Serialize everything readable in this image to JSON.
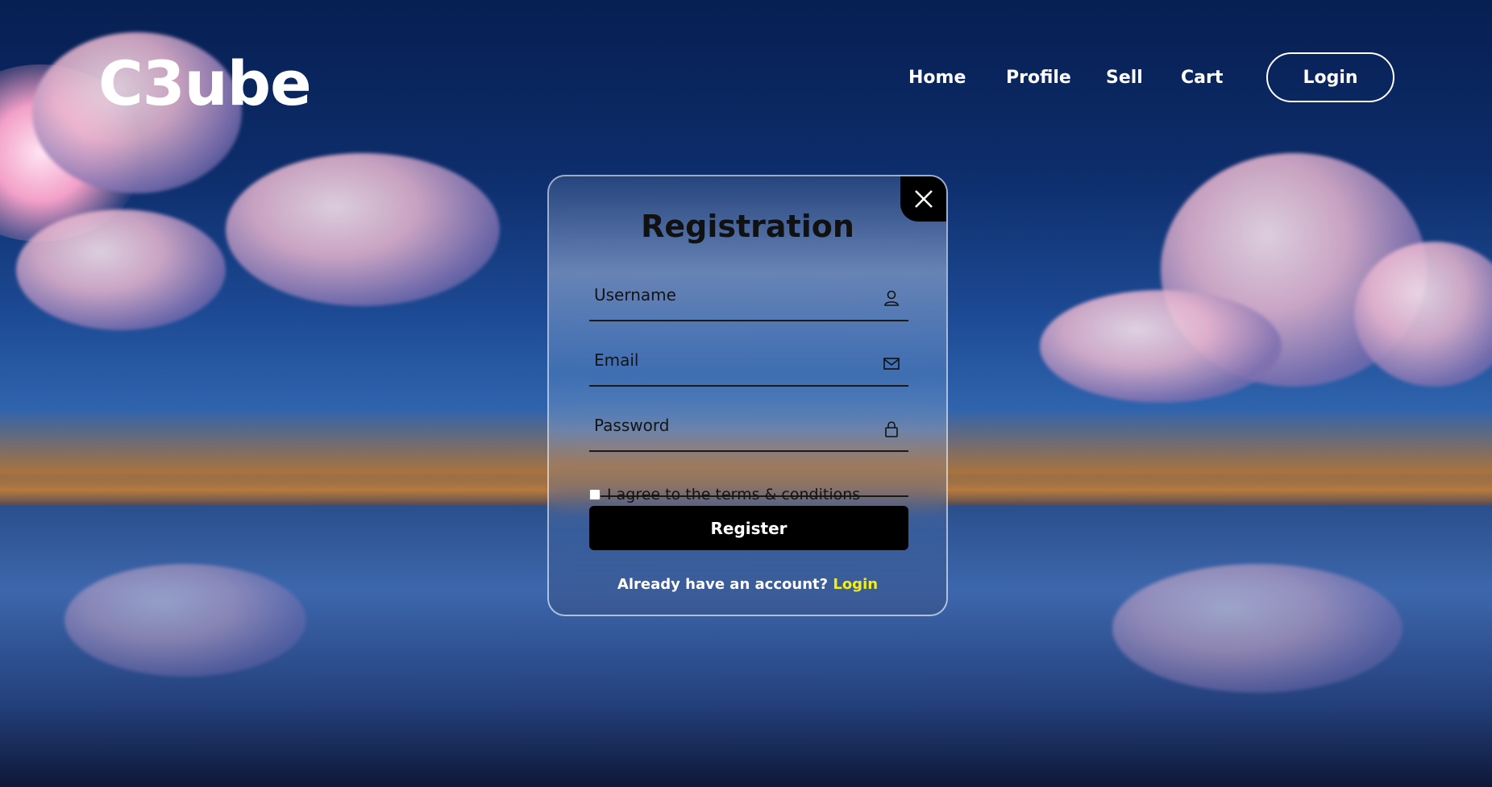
{
  "brand": {
    "logo": "C3ube"
  },
  "nav": {
    "items": [
      {
        "label": "Home"
      },
      {
        "label": "Profile"
      },
      {
        "label": "Sell"
      },
      {
        "label": "Cart"
      }
    ],
    "login_label": "Login"
  },
  "registration": {
    "title": "Registration",
    "username_placeholder": "Username",
    "email_placeholder": "Email",
    "password_placeholder": "Password",
    "terms_label": "I agree to the terms & conditions",
    "terms_checked": false,
    "register_label": "Register",
    "footer_text": "Already have an account?",
    "footer_link": "Login",
    "icons": {
      "close": "close-icon",
      "username": "user-icon",
      "email": "mail-icon",
      "password": "lock-icon"
    }
  },
  "colors": {
    "accent_link": "#f4ee13",
    "button_bg": "#000000"
  }
}
